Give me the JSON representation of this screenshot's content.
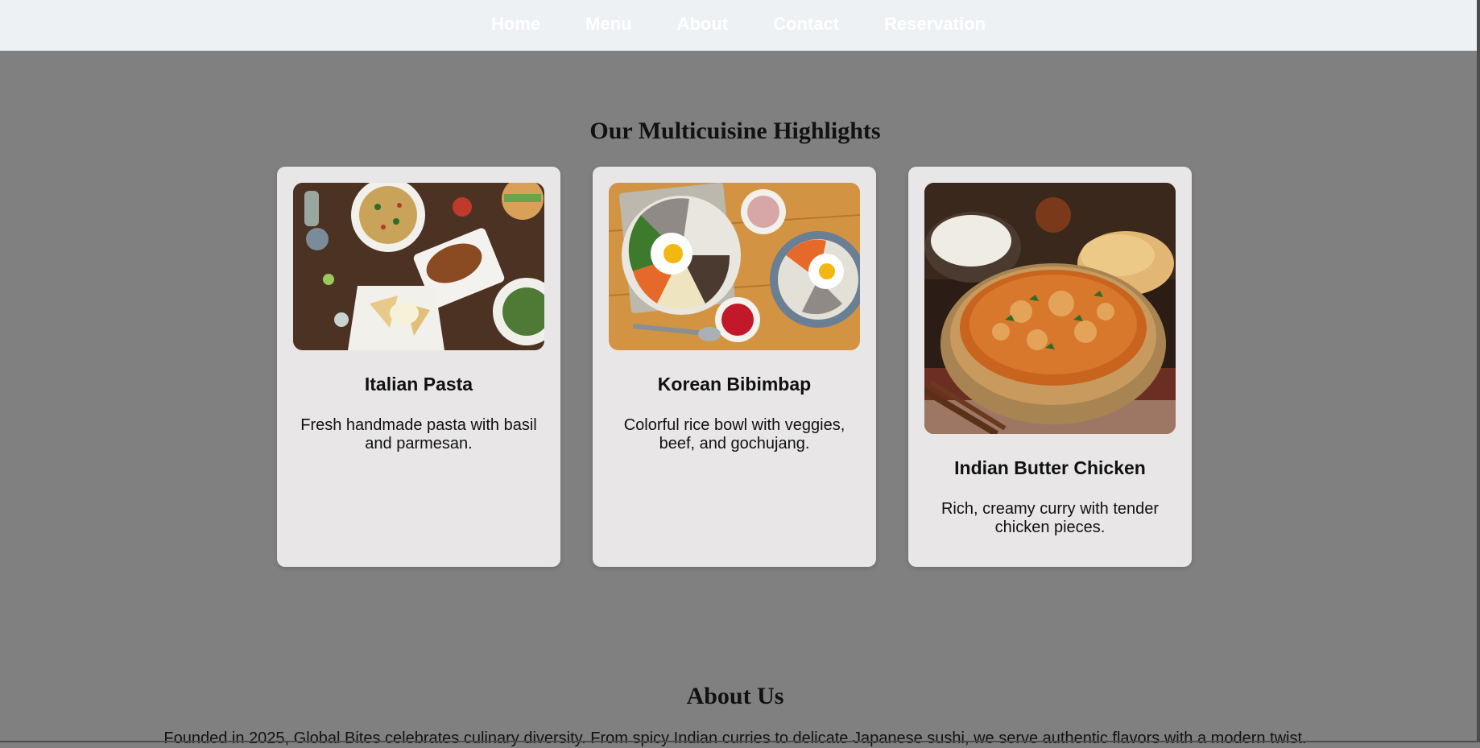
{
  "nav": {
    "items": [
      {
        "label": "Home"
      },
      {
        "label": "Menu"
      },
      {
        "label": "About"
      },
      {
        "label": "Contact"
      },
      {
        "label": "Reservation"
      }
    ]
  },
  "highlights": {
    "title": "Our Multicuisine Highlights",
    "cards": [
      {
        "title": "Italian Pasta",
        "description": "Fresh handmade pasta with basil and parmesan.",
        "image": "food-spread-photo"
      },
      {
        "title": "Korean Bibimbap",
        "description": "Colorful rice bowl with veggies, beef, and gochujang.",
        "image": "bibimbap-photo"
      },
      {
        "title": "Indian Butter Chicken",
        "description": "Rich, creamy curry with tender chicken pieces.",
        "image": "butter-chicken-photo"
      }
    ]
  },
  "about": {
    "title": "About Us",
    "text": "Founded in 2025, Global Bites celebrates culinary diversity. From spicy Indian curries to delicate Japanese sushi, we serve authentic flavors with a modern twist."
  },
  "colors": {
    "page_background": "#808080",
    "navbar_background": "#eef1f4",
    "card_background": "#e8e6e7",
    "nav_text": "#ffffff"
  }
}
